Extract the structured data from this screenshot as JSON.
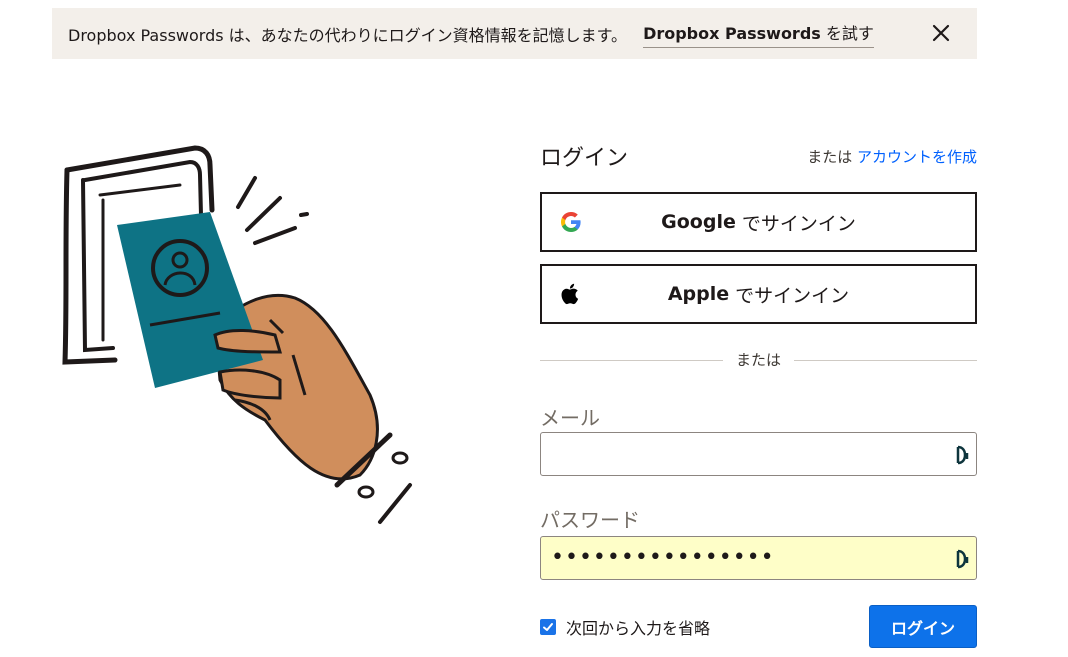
{
  "banner": {
    "message": "Dropbox Passwords は、あなたの代わりにログイン資格情報を記憶します。",
    "link_bold": "Dropbox Passwords",
    "link_rest": "を試す",
    "close_icon": "close-icon"
  },
  "login": {
    "title": "ログイン",
    "or_prefix": "または",
    "create_account": "アカウントを作成",
    "google_brand": "Google",
    "google_rest": "でサインイン",
    "apple_brand": "Apple",
    "apple_rest": "でサインイン",
    "divider_text": "または",
    "email_label": "メール",
    "email_value": "",
    "password_label": "パスワード",
    "password_value": "••••••••••••••••",
    "remember_label": "次回から入力を省略",
    "remember_checked": true,
    "submit_label": "ログイン"
  },
  "colors": {
    "banner_bg": "#f3efea",
    "link_blue": "#0061fe",
    "button_blue": "#0d72ea",
    "autofill_yellow": "#fefec8",
    "card_teal": "#0e7385",
    "hand_tan": "#d08e5c"
  }
}
